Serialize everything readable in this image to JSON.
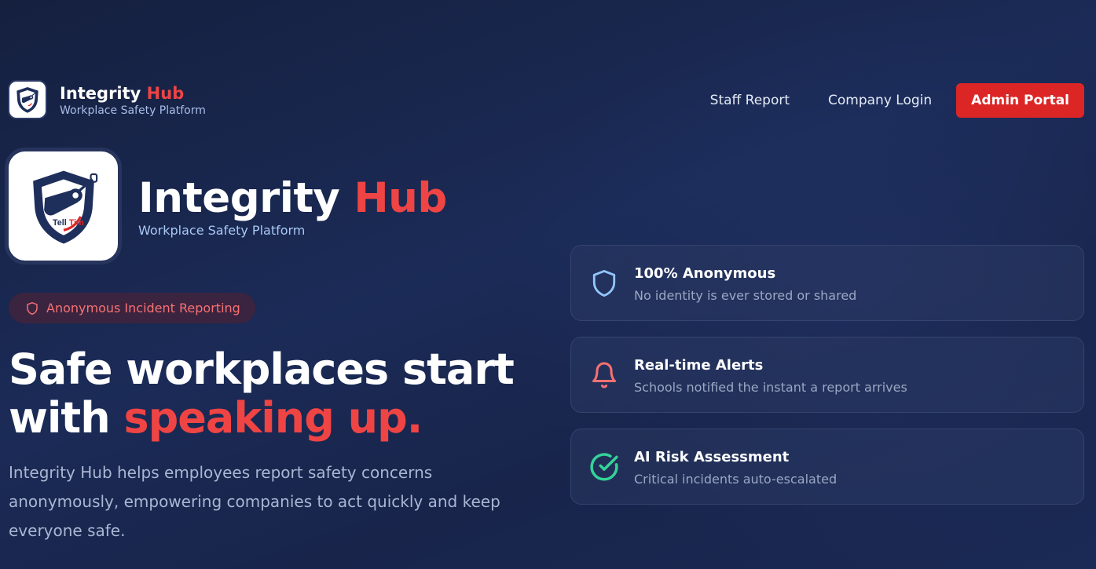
{
  "nav": {
    "brand_main": "Integrity",
    "brand_accent": "Hub",
    "brand_sub": "Workplace Safety Platform",
    "links": [
      "Staff Report",
      "Company Login"
    ],
    "cta": "Admin Portal"
  },
  "hero": {
    "brand_main": "Integrity",
    "brand_accent": "Hub",
    "brand_sub": "Workplace Safety Platform",
    "logo_text_1": "Tell",
    "logo_text_2": "Tim",
    "badge": "Anonymous Incident Reporting",
    "headline_line1": "Safe workplaces start",
    "headline_line2_main": "with",
    "headline_line2_accent": "speaking up.",
    "description": "Integrity Hub helps employees report safety concerns anonymously, empowering companies to act quickly and keep everyone safe."
  },
  "features": [
    {
      "icon": "shield-icon",
      "title": "100% Anonymous",
      "subtitle": "No identity is ever stored or shared"
    },
    {
      "icon": "bell-icon",
      "title": "Real-time Alerts",
      "subtitle": "Schools notified the instant a report arrives"
    },
    {
      "icon": "check-circle-icon",
      "title": "AI Risk Assessment",
      "subtitle": "Critical incidents auto-escalated"
    }
  ],
  "colors": {
    "accent": "#ef4444",
    "button": "#dc2626",
    "background": "#1b2b57",
    "shield_icon": "#93c5fd",
    "bell_icon": "#f87171",
    "check_icon": "#34d399"
  }
}
